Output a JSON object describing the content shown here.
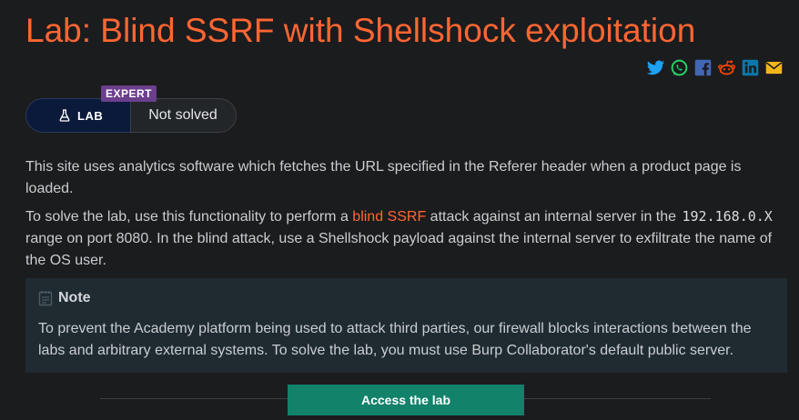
{
  "lab": {
    "title": "Lab: Blind SSRF with Shellshock exploitation",
    "level_badge": "EXPERT",
    "lab_label": "LAB",
    "status": "Not solved"
  },
  "share_icons": [
    "twitter-icon",
    "whatsapp-icon",
    "facebook-icon",
    "reddit-icon",
    "linkedin-icon",
    "email-icon"
  ],
  "description": {
    "p1": "This site uses analytics software which fetches the URL specified in the Referer header when a product page is loaded.",
    "p2_before": "To solve the lab, use this functionality to perform a ",
    "p2_link": "blind SSRF",
    "p2_middle": " attack against an internal server in the ",
    "p2_code": "192.168.0.X",
    "p2_after": " range on port 8080. In the blind attack, use a Shellshock payload against the internal server to exfiltrate the name of the OS user."
  },
  "note": {
    "heading": "Note",
    "body": "To prevent the Academy platform being used to attack third parties, our firewall blocks interactions between the labs and arbitrary external systems. To solve the lab, you must use Burp Collaborator's default public server."
  },
  "access_button": "Access the lab",
  "colors": {
    "accent": "#ff6633",
    "expert": "#6b3f8c",
    "access": "#12826a",
    "background": "#1b1c1e"
  }
}
